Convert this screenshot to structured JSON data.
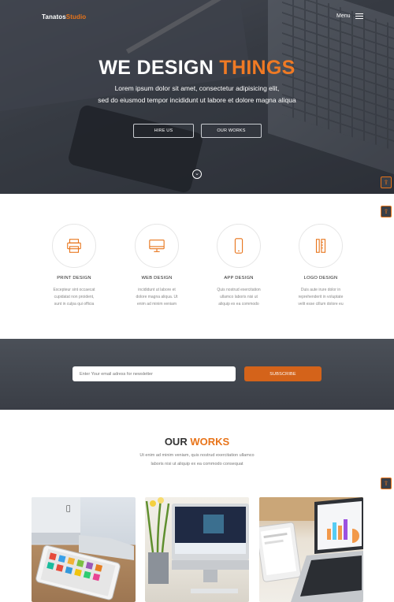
{
  "header": {
    "logo_main": "Tanatos",
    "logo_accent": "Studio",
    "menu_label": "Menu"
  },
  "hero": {
    "title_main": "WE DESIGN",
    "title_accent": "THINGS",
    "subtitle_line1": "Lorem ipsum dolor sit amet, consectetur adipisicing elit,",
    "subtitle_line2": "sed do eiusmod tempor incididunt ut labore et dolore magna aliqua",
    "hire_label": "HIRE US",
    "works_label": "OUR WORKS",
    "scroll_glyph": "⌄"
  },
  "side_tab_glyph": "⇪",
  "services": [
    {
      "title": "PRINT DESIGN",
      "line1": "Excepteur sint occaecat",
      "line2": "cupidatat non proident,",
      "line3": "sunt in culpa qui officia",
      "icon": "printer-icon"
    },
    {
      "title": "WEB DESIGN",
      "line1": "incididunt ut labore et",
      "line2": "dolore magna aliqua. Ut",
      "line3": "enim ad minim veniam",
      "icon": "monitor-icon"
    },
    {
      "title": "APP DESIGN",
      "line1": "Quis nostrud exercitation",
      "line2": "ullamco laboris nisi ut",
      "line3": "aliquip ex ea commodo",
      "icon": "smartphone-icon"
    },
    {
      "title": "LOGO DESIGN",
      "line1": "Duis aute irure dolor in",
      "line2": "reprehenderit in voluptate",
      "line3": "velit esse cillum dolore eu",
      "icon": "pencil-ruler-icon"
    }
  ],
  "newsletter": {
    "placeholder": "Enter Your email adress for newsletter",
    "subscribe_label": "SUBSCRIBE"
  },
  "works": {
    "title_main": "OUR",
    "title_accent": "WORKS",
    "subtitle_line1": "Ut enim ad minim veniam, quis nostrud exercitation ullamco",
    "subtitle_line2": "laboris nisi ut aliquip ex ea commodo consequat"
  },
  "colors": {
    "accent": "#e8741a",
    "button": "#d4631a",
    "hero_overlay": "#3f444c"
  }
}
